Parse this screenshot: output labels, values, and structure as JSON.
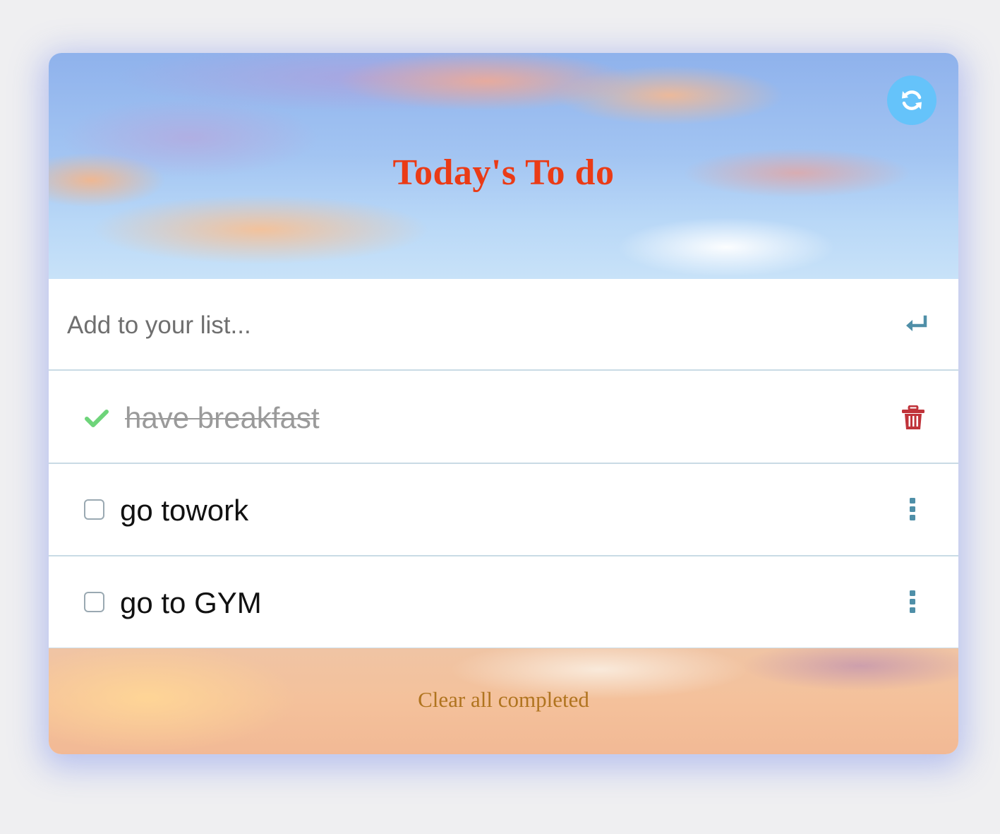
{
  "header": {
    "title": "Today's To do",
    "refresh_icon": "refresh-icon"
  },
  "add_input": {
    "placeholder": "Add to your list...",
    "value": "",
    "enter_icon": "enter-icon"
  },
  "todos": [
    {
      "text": "have breakfast",
      "completed": true,
      "status_icon": "checkmark-icon",
      "action_icon": "trash-icon"
    },
    {
      "text": "go towork",
      "completed": false,
      "status_icon": "checkbox",
      "action_icon": "more-vertical-icon"
    },
    {
      "text": "go to GYM",
      "completed": false,
      "status_icon": "checkbox",
      "action_icon": "more-vertical-icon"
    }
  ],
  "footer": {
    "clear_label": "Clear all completed"
  },
  "colors": {
    "title": "#ea3b16",
    "refresh_button": "#62c3fa",
    "check": "#6ed47a",
    "trash": "#c0333a",
    "menu_dots": "#4f8fa8",
    "footer_text": "#b0741f"
  }
}
